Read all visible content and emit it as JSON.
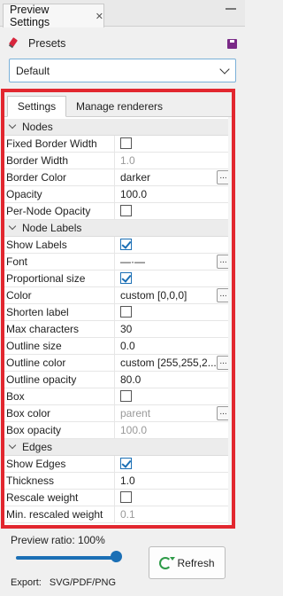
{
  "title": "Preview Settings",
  "presets": {
    "label": "Presets"
  },
  "preset_dropdown": {
    "value": "Default"
  },
  "tabs": [
    {
      "label": "Settings",
      "active": true
    },
    {
      "label": "Manage renderers",
      "active": false
    }
  ],
  "sections": {
    "nodes": "Nodes",
    "node_labels": "Node Labels",
    "edges": "Edges"
  },
  "properties": {
    "fixed_border_width": {
      "label": "Fixed Border Width",
      "checked": false
    },
    "border_width": {
      "label": "Border Width",
      "value": "1.0"
    },
    "border_color": {
      "label": "Border Color",
      "value": "darker"
    },
    "opacity": {
      "label": "Opacity",
      "value": "100.0"
    },
    "per_node_opacity": {
      "label": "Per-Node Opacity",
      "checked": false
    },
    "show_labels": {
      "label": "Show Labels",
      "checked": true
    },
    "font": {
      "label": "Font",
      "value": "—·—"
    },
    "proportional_size": {
      "label": "Proportional size",
      "checked": true
    },
    "color": {
      "label": "Color",
      "value": "custom [0,0,0]"
    },
    "shorten_label": {
      "label": "Shorten label",
      "checked": false
    },
    "max_characters": {
      "label": "Max characters",
      "value": "30"
    },
    "outline_size": {
      "label": "Outline size",
      "value": "0.0"
    },
    "outline_color": {
      "label": "Outline color",
      "value": "custom [255,255,2..."
    },
    "outline_opacity": {
      "label": "Outline opacity",
      "value": "80.0"
    },
    "box": {
      "label": "Box",
      "checked": false
    },
    "box_color": {
      "label": "Box color",
      "value": "parent"
    },
    "box_opacity": {
      "label": "Box opacity",
      "value": "100.0"
    },
    "show_edges": {
      "label": "Show Edges",
      "checked": true
    },
    "thickness": {
      "label": "Thickness",
      "value": "1.0"
    },
    "rescale_weight": {
      "label": "Rescale weight",
      "checked": false
    },
    "min_rescaled_weight": {
      "label": "Min. rescaled weight",
      "value": "0.1"
    }
  },
  "preview_ratio": {
    "label": "Preview ratio:",
    "value": "100%",
    "fraction": 1.0
  },
  "refresh_button": {
    "label": "Refresh"
  },
  "export": {
    "label": "Export:",
    "formats": "SVG/PDF/PNG"
  },
  "colors": {
    "highlight": "#e2272f",
    "accent": "#1b6fb5",
    "refresh_icon": "#2e9b48"
  }
}
